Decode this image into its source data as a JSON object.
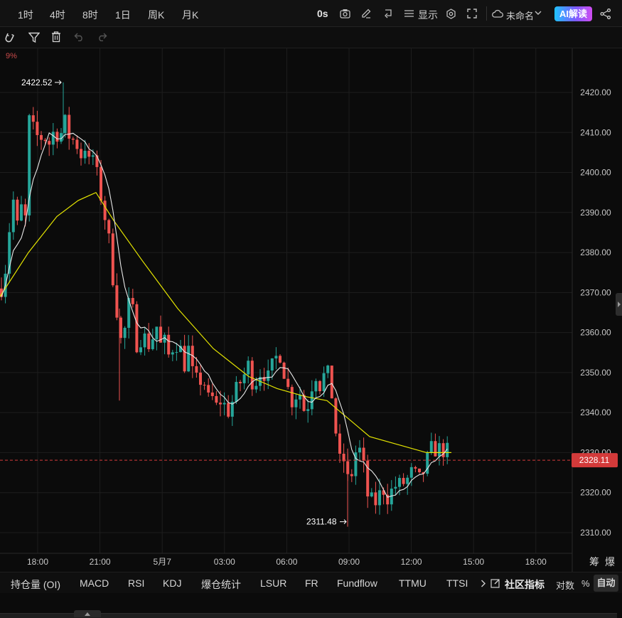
{
  "toolbar": {
    "timeframes": [
      "1时",
      "4时",
      "8时",
      "1日",
      "周K",
      "月K"
    ],
    "countdown": "0s",
    "display_label": "显示",
    "layout_name": "未命名",
    "ai_button": "AI解读"
  },
  "drawbar": {
    "partial_label": "9%"
  },
  "chart_data": {
    "type": "candlestick",
    "y_ticks": [
      "2420.00",
      "2410.00",
      "2400.00",
      "2390.00",
      "2380.00",
      "2370.00",
      "2360.00",
      "2350.00",
      "2340.00",
      "2330.00",
      "2320.00",
      "2310.00"
    ],
    "x_ticks": [
      "18:00",
      "21:00",
      "5月7",
      "03:00",
      "06:00",
      "09:00",
      "12:00",
      "15:00",
      "18:00"
    ],
    "ylim": [
      2305.5,
      2429.3
    ],
    "grid": true,
    "current_price": "2328.11",
    "current_price_value": 2328.11,
    "high_marker": "2422.52",
    "high_value": 2422.52,
    "low_marker": "2311.48",
    "low_value": 2311.48,
    "scale_labels": [
      "筹",
      "爆"
    ],
    "colors": {
      "up": "#26a69a",
      "down": "#ef5350",
      "ma_fast": "#e8e8e8",
      "ma_slow": "#e5e500",
      "price_line": "#d33a3a"
    }
  },
  "indicators": [
    "持仓量 (OI)",
    "MACD",
    "RSI",
    "KDJ",
    "爆仓统计",
    "LSUR",
    "FR",
    "Fundflow",
    "TTMU",
    "TTSI"
  ],
  "indicator_bar": {
    "community_label": "社区指标",
    "log_label": "对数",
    "pct_label": "%",
    "auto_label": "自动"
  }
}
